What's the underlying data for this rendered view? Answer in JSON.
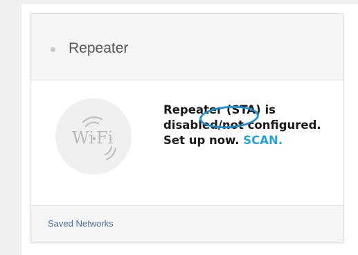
{
  "card": {
    "title": "Repeater",
    "status_color": "#c8c8c8",
    "icon": "wifi-logo-icon",
    "message_text": "Repeater (STA) is disabled/not configured. Set up now.",
    "scan_label": "SCAN.",
    "scan_color": "#25a3d8",
    "highlight_color": "#1e8fd0"
  },
  "footer": {
    "saved_networks_label": "Saved Networks"
  }
}
